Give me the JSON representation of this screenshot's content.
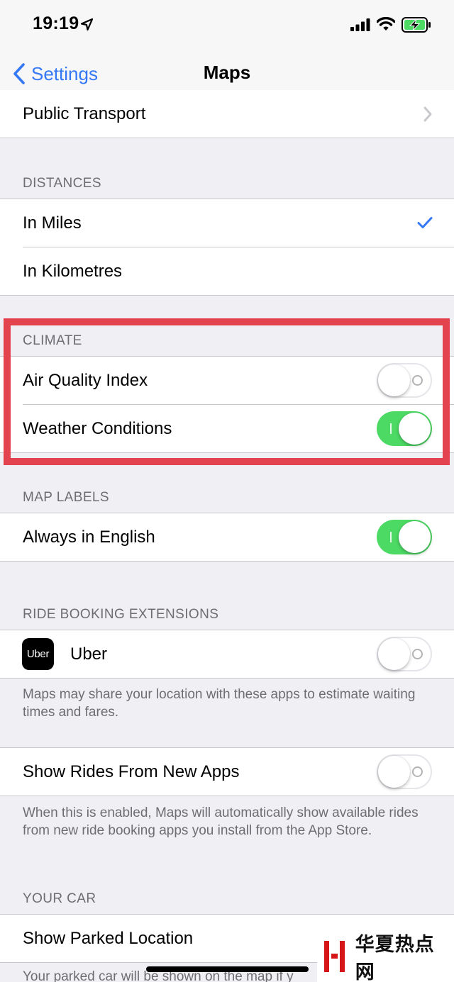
{
  "status_bar": {
    "time": "19:19",
    "icons": [
      "location-arrow-icon",
      "cellular-signal-icon",
      "wifi-icon",
      "battery-charging-icon"
    ]
  },
  "nav": {
    "back_label": "Settings",
    "title": "Maps"
  },
  "rows": {
    "public_transport": "Public Transport",
    "in_miles": "In Miles",
    "in_kilometres": "In Kilometres",
    "air_quality_index": "Air Quality Index",
    "weather_conditions": "Weather Conditions",
    "always_in_english": "Always in English",
    "uber": "Uber",
    "show_rides_from_new_apps": "Show Rides From New Apps",
    "show_parked_location": "Show Parked Location"
  },
  "sections": {
    "distances": "DISTANCES",
    "climate": "CLIMATE",
    "map_labels": "MAP LABELS",
    "ride_booking_extensions": "RIDE BOOKING EXTENSIONS",
    "your_car": "YOUR CAR"
  },
  "notes": {
    "ride_share": "Maps may share your location with these apps to estimate waiting times and fares.",
    "new_apps": "When this is enabled, Maps will automatically show available rides from new ride booking apps you install from the App Store.",
    "parked_car": "Your parked car will be shown on the map if y"
  },
  "app_icon_label": "Uber",
  "toggles": {
    "air_quality_index": false,
    "weather_conditions": true,
    "always_in_english": true,
    "uber": false,
    "show_rides_from_new_apps": false
  },
  "selected_distance": "In Miles",
  "watermark": {
    "text": "华夏热点网"
  },
  "colors": {
    "accent": "#3478f6",
    "toggle_on": "#4cd964",
    "highlight_border": "#e3434e",
    "grouped_background": "#efeff4",
    "section_text": "#6d6d72"
  }
}
